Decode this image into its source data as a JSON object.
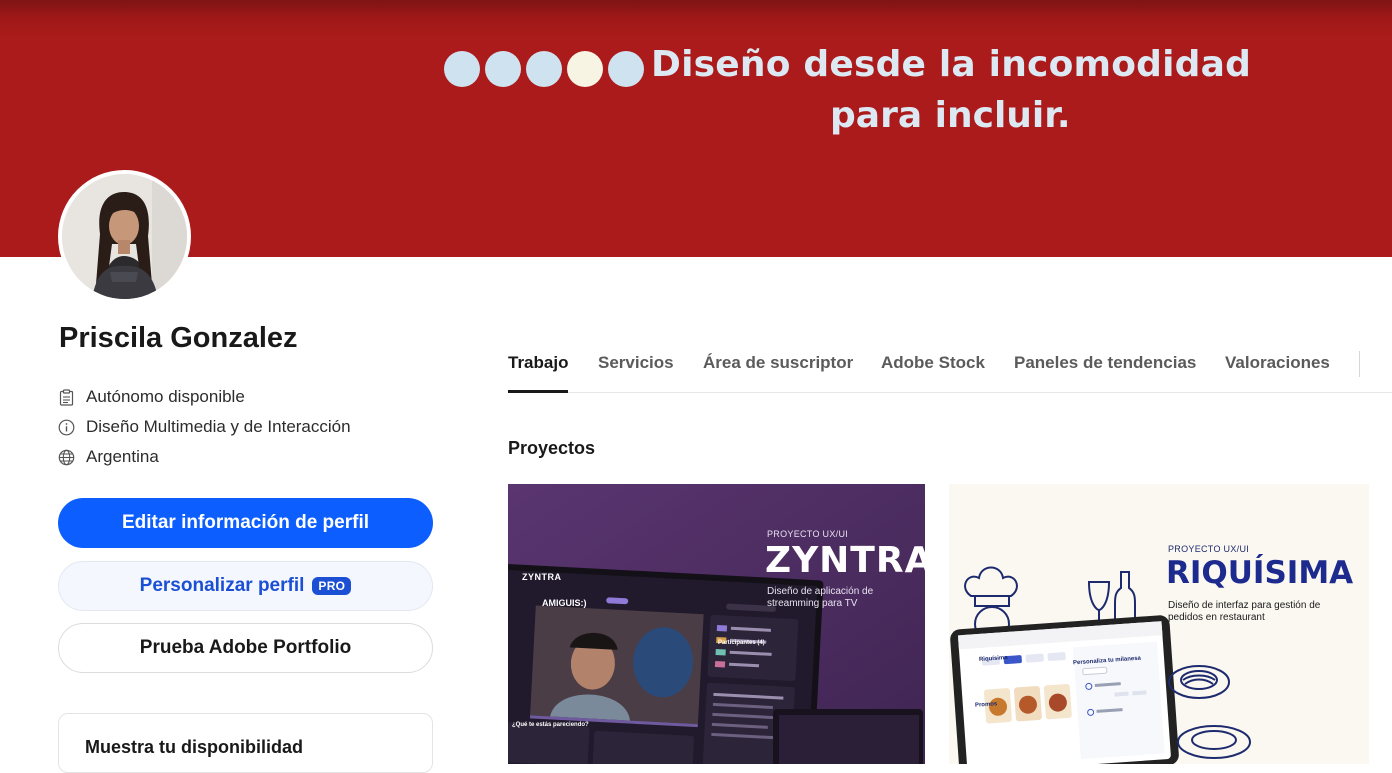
{
  "banner": {
    "dots": [
      "#cfe2f0",
      "#cfe2f0",
      "#cfe2f0",
      "#f7f4e4",
      "#cfe2f0"
    ],
    "line1": "Diseño desde la incomodidad",
    "line2": "para incluir.",
    "bg_color": "#ab1b1b"
  },
  "profile": {
    "name": "Priscila Gonzalez",
    "info": [
      {
        "icon": "clipboard-icon",
        "text": "Autónomo disponible"
      },
      {
        "icon": "info-icon",
        "text": "Diseño Multimedia y de Interacción"
      },
      {
        "icon": "globe-icon",
        "text": "Argentina"
      }
    ],
    "buttons": {
      "edit": "Editar información de perfil",
      "customize": "Personalizar perfil",
      "pro_badge": "PRO",
      "portfolio": "Prueba Adobe Portfolio"
    },
    "availability": "Muestra tu disponibilidad"
  },
  "tabs": [
    {
      "label": "Trabajo",
      "active": true
    },
    {
      "label": "Servicios",
      "active": false
    },
    {
      "label": "Área de suscriptor",
      "active": false
    },
    {
      "label": "Adobe Stock",
      "active": false
    },
    {
      "label": "Paneles de tendencias",
      "active": false
    },
    {
      "label": "Valoraciones",
      "active": false
    }
  ],
  "projects": {
    "title": "Proyectos",
    "items": [
      {
        "kicker": "PROYECTO UX/UI",
        "title": "ZYNTRA",
        "subtitle1": "Diseño de aplicación de",
        "subtitle2": "streamming para TV",
        "app_logo": "ZYNTRA",
        "app_channel": "AMIGUIS:)",
        "panel_heading": "Participantes (4)",
        "question": "¿Qué te estás pareciendo?"
      },
      {
        "kicker": "PROYECTO UX/UI",
        "title": "RIQUÍSIMA",
        "subtitle1": "Diseño de interfaz para gestión de",
        "subtitle2": "pedidos en restaurant",
        "app_header": "Riquísima",
        "app_panel": "Personaliza tu milanesa",
        "app_section": "Promos"
      }
    ]
  }
}
